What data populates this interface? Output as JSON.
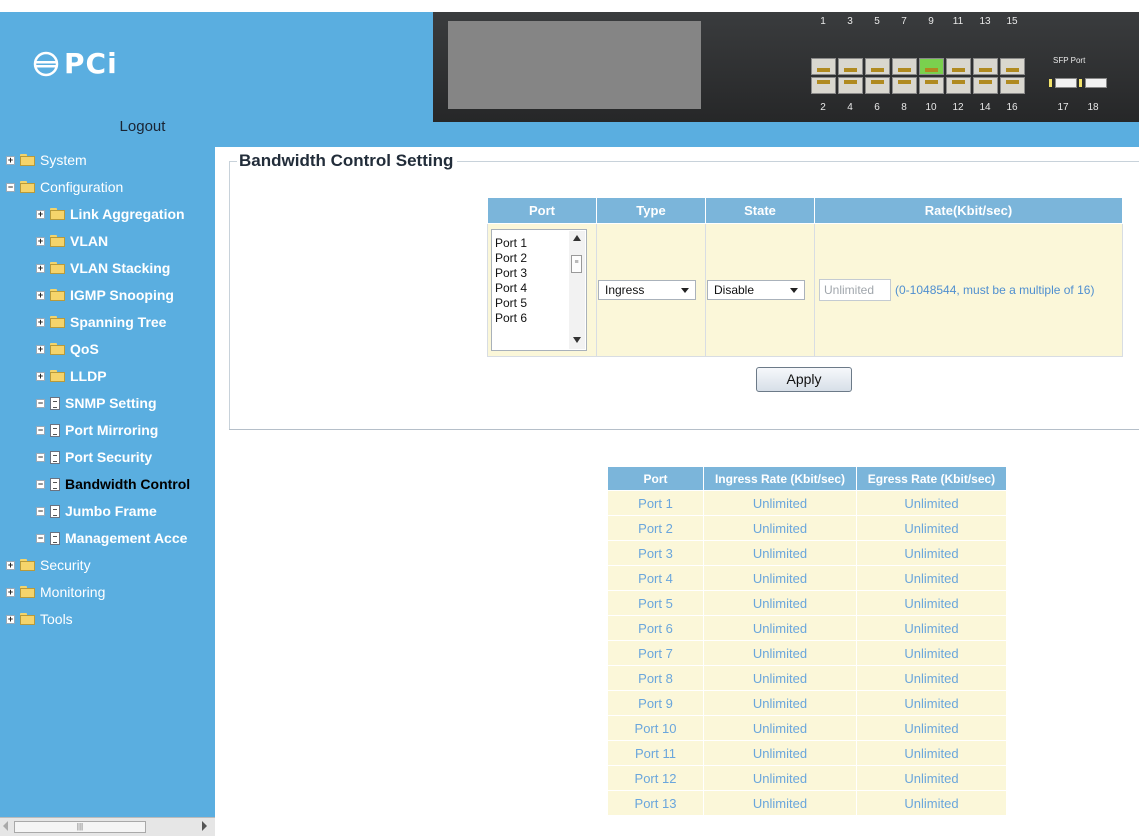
{
  "header": {
    "logo_text": "PCi",
    "logout_label": "Logout",
    "panel": {
      "top_ports": [
        "1",
        "3",
        "5",
        "7",
        "9",
        "11",
        "13",
        "15"
      ],
      "bottom_ports": [
        "2",
        "4",
        "6",
        "8",
        "10",
        "12",
        "14",
        "16"
      ],
      "sfp_label": "SFP Port",
      "sfp_ports": [
        "17",
        "18"
      ]
    }
  },
  "sidebar": {
    "items": [
      {
        "label": "System",
        "icon": "folder-icon",
        "expander": "+"
      },
      {
        "label": "Configuration",
        "icon": "folder-open-icon",
        "expander": "−"
      },
      {
        "label": "Link Aggregation",
        "icon": "folder-icon",
        "expander": "+"
      },
      {
        "label": "VLAN",
        "icon": "folder-icon",
        "expander": "+"
      },
      {
        "label": "VLAN Stacking",
        "icon": "folder-icon",
        "expander": "+"
      },
      {
        "label": "IGMP Snooping",
        "icon": "folder-icon",
        "expander": "+"
      },
      {
        "label": "Spanning Tree",
        "icon": "folder-icon",
        "expander": "+"
      },
      {
        "label": "QoS",
        "icon": "folder-icon",
        "expander": "+"
      },
      {
        "label": "LLDP",
        "icon": "folder-icon",
        "expander": "+"
      },
      {
        "label": "SNMP Setting",
        "icon": "document-icon",
        "expander": "−"
      },
      {
        "label": "Port Mirroring",
        "icon": "document-icon",
        "expander": "−"
      },
      {
        "label": "Port Security",
        "icon": "document-icon",
        "expander": "−"
      },
      {
        "label": "Bandwidth Control",
        "icon": "document-icon",
        "expander": "−"
      },
      {
        "label": "Jumbo Frame",
        "icon": "document-icon",
        "expander": "−"
      },
      {
        "label": "Management Acce",
        "icon": "document-icon",
        "expander": "−"
      },
      {
        "label": "Security",
        "icon": "folder-icon",
        "expander": "+"
      },
      {
        "label": "Monitoring",
        "icon": "folder-icon",
        "expander": "+"
      },
      {
        "label": "Tools",
        "icon": "folder-icon",
        "expander": "+"
      }
    ]
  },
  "main": {
    "title": "Bandwidth Control Setting",
    "control_table": {
      "headers": [
        "Port",
        "Type",
        "State",
        "Rate(Kbit/sec)"
      ],
      "port_options": [
        "Port 1",
        "Port 2",
        "Port 3",
        "Port 4",
        "Port 5",
        "Port 6"
      ],
      "type_value": "Ingress",
      "state_value": "Disable",
      "rate_placeholder": "Unlimited",
      "rate_hint": "(0-1048544, must be a multiple of 16)"
    },
    "apply_label": "Apply",
    "status_table": {
      "headers": [
        "Port",
        "Ingress Rate (Kbit/sec)",
        "Egress Rate (Kbit/sec)"
      ],
      "rows": [
        [
          "Port 1",
          "Unlimited",
          "Unlimited"
        ],
        [
          "Port 2",
          "Unlimited",
          "Unlimited"
        ],
        [
          "Port 3",
          "Unlimited",
          "Unlimited"
        ],
        [
          "Port 4",
          "Unlimited",
          "Unlimited"
        ],
        [
          "Port 5",
          "Unlimited",
          "Unlimited"
        ],
        [
          "Port 6",
          "Unlimited",
          "Unlimited"
        ],
        [
          "Port 7",
          "Unlimited",
          "Unlimited"
        ],
        [
          "Port 8",
          "Unlimited",
          "Unlimited"
        ],
        [
          "Port 9",
          "Unlimited",
          "Unlimited"
        ],
        [
          "Port 10",
          "Unlimited",
          "Unlimited"
        ],
        [
          "Port 11",
          "Unlimited",
          "Unlimited"
        ],
        [
          "Port 12",
          "Unlimited",
          "Unlimited"
        ],
        [
          "Port 13",
          "Unlimited",
          "Unlimited"
        ]
      ]
    }
  },
  "colors": {
    "sidebar_bg": "#5aaee0",
    "table_header": "#7bb5da",
    "table_cell": "#fbf7d9",
    "link_text": "#6aa6dc",
    "active_port_led": "#7ad14e"
  }
}
